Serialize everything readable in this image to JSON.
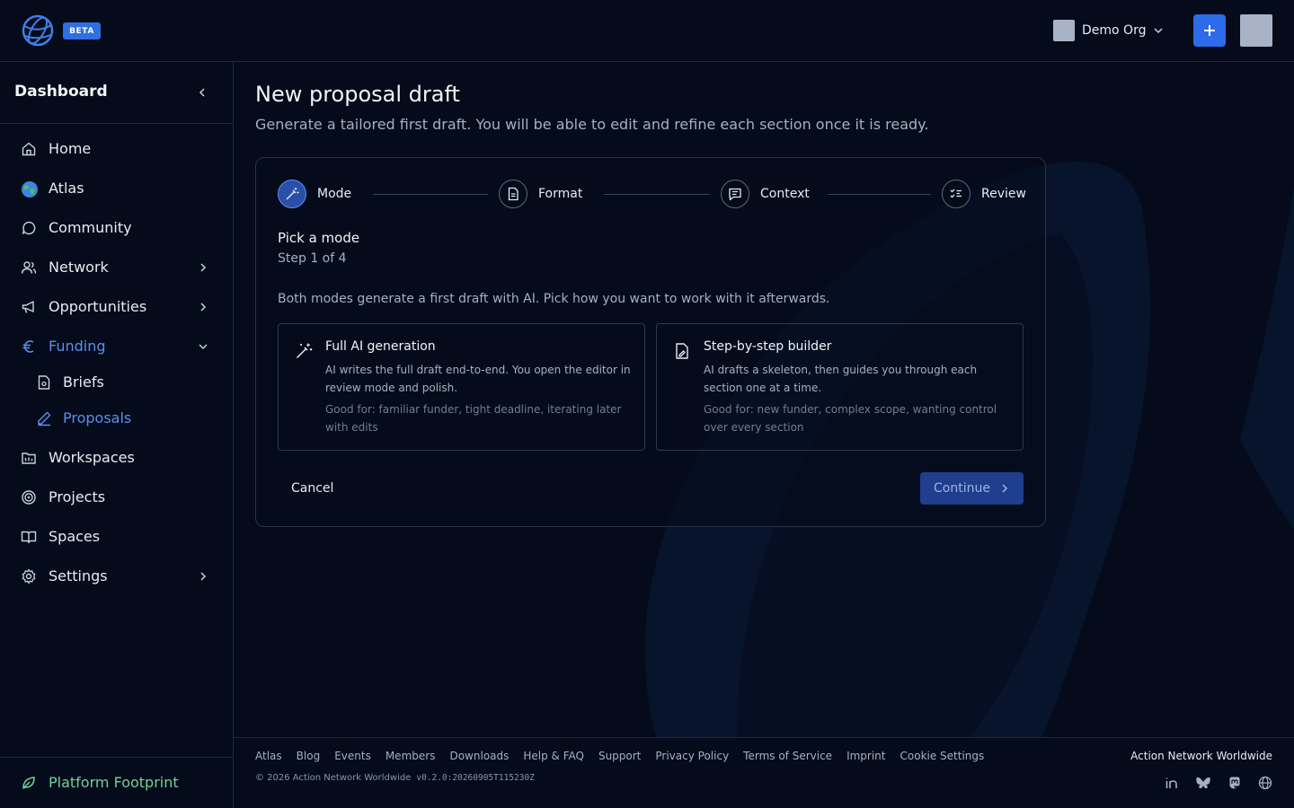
{
  "topbar": {
    "beta": "BETA",
    "org_name": "Demo Org"
  },
  "sidebar": {
    "title": "Dashboard",
    "items": [
      {
        "label": "Home",
        "icon": "home-icon"
      },
      {
        "label": "Atlas",
        "icon": "globe-emoji-icon"
      },
      {
        "label": "Community",
        "icon": "chat-bubble-icon"
      },
      {
        "label": "Network",
        "icon": "users-icon"
      },
      {
        "label": "Opportunities",
        "icon": "megaphone-icon"
      },
      {
        "label": "Funding",
        "icon": "euro-icon"
      },
      {
        "label": "Briefs",
        "icon": "document-icon"
      },
      {
        "label": "Proposals",
        "icon": "pen-icon"
      },
      {
        "label": "Workspaces",
        "icon": "folder-icon"
      },
      {
        "label": "Projects",
        "icon": "target-icon"
      },
      {
        "label": "Spaces",
        "icon": "book-icon"
      },
      {
        "label": "Settings",
        "icon": "gear-icon"
      }
    ],
    "footer_label": "Platform Footprint"
  },
  "main": {
    "title": "New proposal draft",
    "subtitle": "Generate a tailored first draft. You will be able to edit and refine each section once it is ready.",
    "steps": [
      {
        "label": "Mode"
      },
      {
        "label": "Format"
      },
      {
        "label": "Context"
      },
      {
        "label": "Review"
      }
    ],
    "pick_title": "Pick a mode",
    "pick_step": "Step 1 of 4",
    "pick_desc": "Both modes generate a first draft with AI. Pick how you want to work with it afterwards.",
    "modes": [
      {
        "title": "Full AI generation",
        "desc": "AI writes the full draft end-to-end. You open the editor in review mode and polish.",
        "good_for": "Good for: familiar funder, tight deadline, iterating later with edits"
      },
      {
        "title": "Step-by-step builder",
        "desc": "AI drafts a skeleton, then guides you through each section one at a time.",
        "good_for": "Good for: new funder, complex scope, wanting control over every section"
      }
    ],
    "cancel": "Cancel",
    "continue": "Continue"
  },
  "footer": {
    "links": [
      "Atlas",
      "Blog",
      "Events",
      "Members",
      "Downloads",
      "Help & FAQ",
      "Support",
      "Privacy Policy",
      "Terms of Service",
      "Imprint",
      "Cookie Settings"
    ],
    "copyright": "© 2026 Action Network Worldwide",
    "version": "v0.2.0:20260905T115230Z",
    "org": "Action Network Worldwide",
    "socials": [
      "linkedin-icon",
      "bluesky-icon",
      "mastodon-icon",
      "globe-icon"
    ]
  },
  "colors": {
    "background": "#050b1a",
    "accent": "#2d6ce8",
    "active_nav": "#5b8ef0",
    "footprint": "#6fd39a"
  }
}
